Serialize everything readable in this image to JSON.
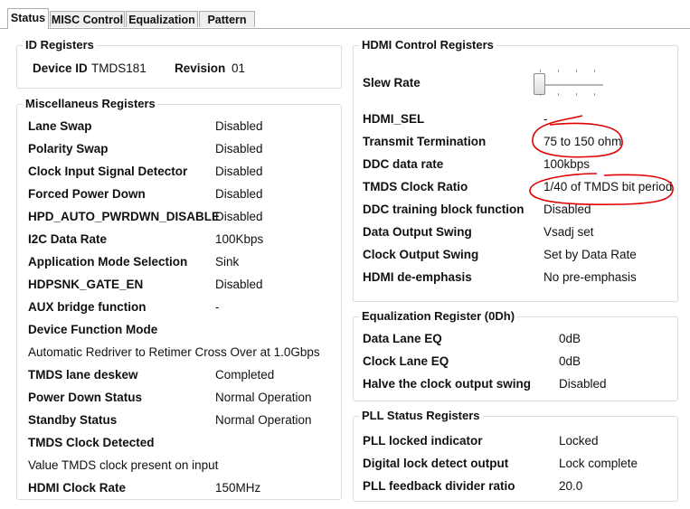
{
  "tabs": [
    "Status",
    "MISC Control",
    "Equalization",
    "Pattern"
  ],
  "active_tab": "Status",
  "id_registers": {
    "title": "ID Registers",
    "device_id_label": "Device ID",
    "device_id_value": "TMDS181",
    "revision_label": "Revision",
    "revision_value": "01"
  },
  "misc": {
    "title": "Miscellaneus Registers",
    "rows": [
      {
        "label": "Lane Swap",
        "value": "Disabled"
      },
      {
        "label": "Polarity Swap",
        "value": "Disabled"
      },
      {
        "label": "Clock Input Signal Detector",
        "value": "Disabled"
      },
      {
        "label": "Forced Power Down",
        "value": "Disabled"
      },
      {
        "label": "HPD_AUTO_PWRDWN_DISABLE",
        "value": "Disabled"
      },
      {
        "label": "I2C Data Rate",
        "value": "100Kbps"
      },
      {
        "label": "Application Mode Selection",
        "value": "Sink"
      },
      {
        "label": "HDPSNK_GATE_EN",
        "value": "Disabled"
      },
      {
        "label": "AUX bridge function",
        "value": "-"
      },
      {
        "label": "Device Function Mode",
        "value": ""
      },
      {
        "label": "Automatic Redriver to Retimer Cross Over at 1.0Gbps",
        "value": "",
        "plain": true
      },
      {
        "label": "TMDS lane deskew",
        "value": "Completed"
      },
      {
        "label": "Power Down Status",
        "value": "Normal Operation"
      },
      {
        "label": "Standby Status",
        "value": "Normal Operation"
      },
      {
        "label": "TMDS Clock Detected",
        "value": ""
      },
      {
        "label": "Value TMDS clock present on input",
        "value": "",
        "plain": true
      },
      {
        "label": "HDMI Clock Rate",
        "value": "150MHz"
      }
    ]
  },
  "hdmi": {
    "title": "HDMI Control Registers",
    "slew_rate_label": "Slew Rate",
    "slew_rate_level": 0,
    "rows": [
      {
        "label": "HDMI_SEL",
        "value": "-"
      },
      {
        "label": "Transmit Termination",
        "value": "75 to 150 ohm"
      },
      {
        "label": "DDC data rate",
        "value": "100kbps"
      },
      {
        "label": "TMDS Clock Ratio",
        "value": "1/40 of TMDS bit period"
      },
      {
        "label": "DDC training block function",
        "value": "Disabled"
      },
      {
        "label": "Data Output Swing",
        "value": "Vsadj set"
      },
      {
        "label": "Clock Output Swing",
        "value": "Set by Data Rate"
      },
      {
        "label": "HDMI de-emphasis",
        "value": "No pre-emphasis"
      }
    ]
  },
  "eq": {
    "title": "Equalization Register (0Dh)",
    "rows": [
      {
        "label": "Data Lane EQ",
        "value": "0dB"
      },
      {
        "label": "Clock Lane EQ",
        "value": "0dB"
      },
      {
        "label": "Halve the clock output swing",
        "value": "Disabled"
      }
    ]
  },
  "pll": {
    "title": "PLL Status Registers",
    "rows": [
      {
        "label": "PLL locked indicator",
        "value": "Locked"
      },
      {
        "label": "Digital lock detect output",
        "value": "Lock complete"
      },
      {
        "label": "PLL feedback divider ratio",
        "value": "20.0"
      }
    ]
  },
  "colors": {
    "annotation": "#e00000",
    "border": "#dcdcdc",
    "tab_bg": "#eeeeee"
  }
}
